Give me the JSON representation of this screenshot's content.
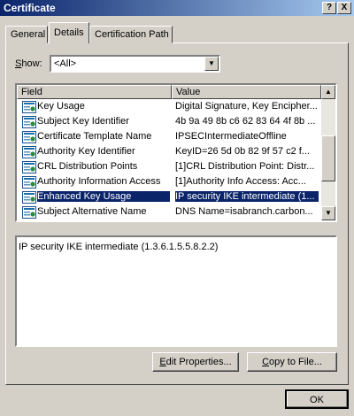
{
  "window": {
    "title": "Certificate",
    "help_label": "?",
    "close_label": "X"
  },
  "tabs": [
    {
      "label": "General"
    },
    {
      "label": "Details"
    },
    {
      "label": "Certification Path"
    }
  ],
  "show": {
    "label_u": "S",
    "label_rest": "how:",
    "selected": "<All>"
  },
  "list": {
    "headers": {
      "field": "Field",
      "value": "Value"
    },
    "rows": [
      {
        "name": "Key Usage",
        "value": "Digital Signature, Key Encipher..."
      },
      {
        "name": "Subject Key Identifier",
        "value": "4b 9a 49 8b c6 62 83 64 4f 8b ..."
      },
      {
        "name": "Certificate Template Name",
        "value": "IPSECIntermediateOffline"
      },
      {
        "name": "Authority Key Identifier",
        "value": "KeyID=26 5d 0b 82 9f 57 c2 f..."
      },
      {
        "name": "CRL Distribution Points",
        "value": "[1]CRL Distribution Point: Distr..."
      },
      {
        "name": "Authority Information Access",
        "value": "[1]Authority Info Access: Acc..."
      },
      {
        "name": "Enhanced Key Usage",
        "value": "IP security IKE intermediate (1...",
        "selected": true
      },
      {
        "name": "Subject Alternative Name",
        "value": "DNS Name=isabranch.carbon..."
      }
    ],
    "scroll_position": 0.6
  },
  "detail_text": "IP security IKE intermediate (1.3.6.1.5.5.8.2.2)",
  "buttons": {
    "edit_u": "E",
    "edit_rest": "dit Properties...",
    "copy_u": "C",
    "copy_rest": "opy to File...",
    "ok": "OK"
  },
  "icon": "certificate-field-icon"
}
